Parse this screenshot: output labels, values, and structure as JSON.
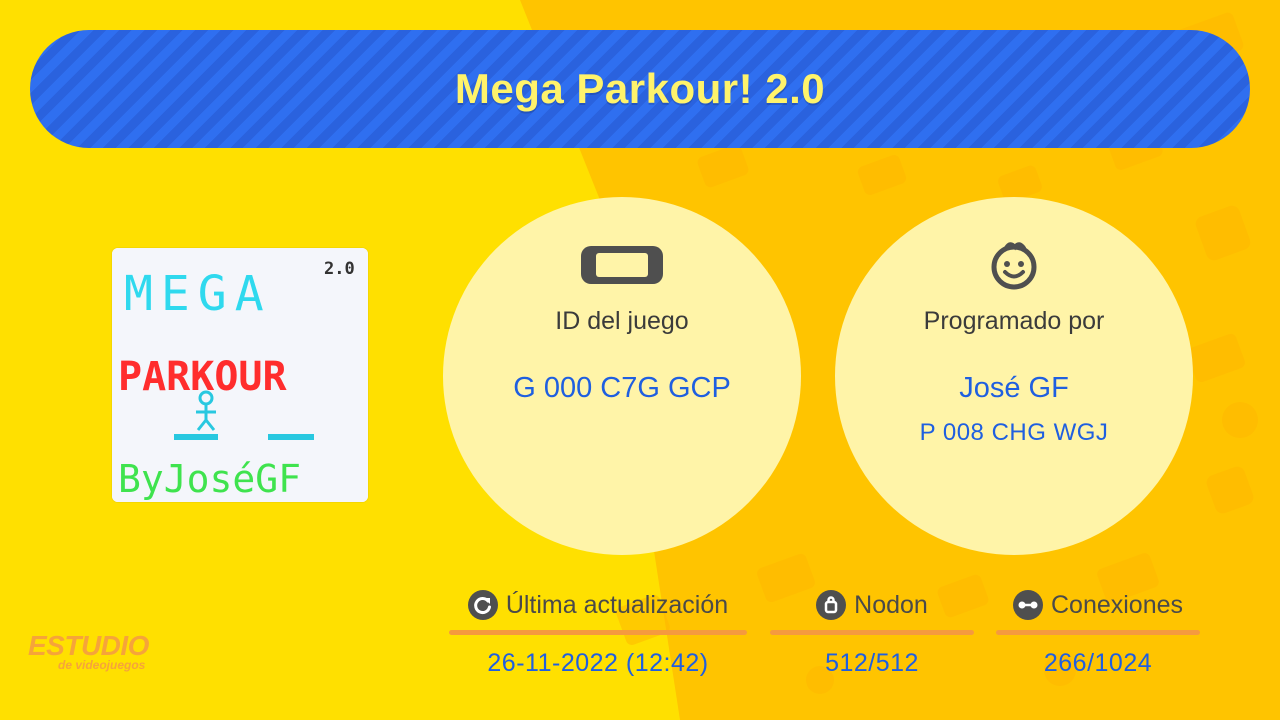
{
  "title": "Mega Parkour! 2.0",
  "thumbnail": {
    "line1": "MEGA",
    "version": "2.0",
    "line2": "PARKOUR",
    "line3": "ByJoséGF"
  },
  "game_id": {
    "icon": "switch-console-icon",
    "label": "ID del juego",
    "value": "G 000 C7G GCP"
  },
  "programmer": {
    "icon": "smiley-face-icon",
    "label": "Programado por",
    "name": "José GF",
    "id": "P 008 CHG WGJ"
  },
  "stats": {
    "updated": {
      "icon": "refresh-icon",
      "label": "Última actualización",
      "value": "26-11-2022 (12:42)"
    },
    "nodon": {
      "icon": "bag-icon",
      "label": "Nodon",
      "value": "512/512"
    },
    "connections": {
      "icon": "connection-icon",
      "label": "Conexiones",
      "value": "266/1024"
    }
  },
  "logo": {
    "main": "ESTUDIO",
    "sub": "de videojuegos"
  },
  "colors": {
    "background": "#ffe000",
    "background_alt": "#ffc400",
    "title_bar": "#2f6ff0",
    "title_text": "#fff36b",
    "value_blue": "#1f5fe0",
    "accent_orange": "#f59a3e"
  }
}
